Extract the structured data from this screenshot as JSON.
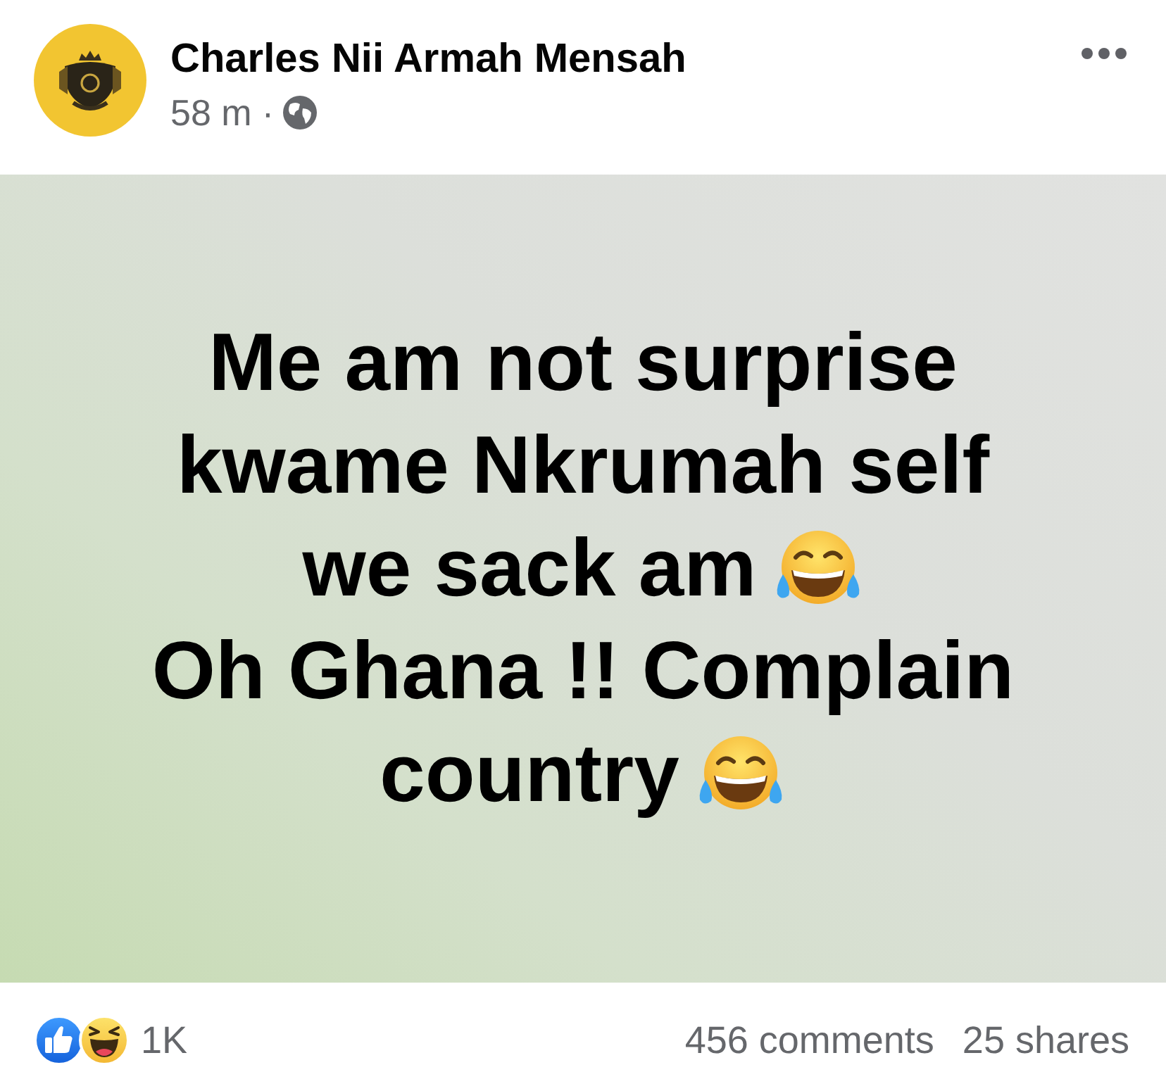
{
  "post": {
    "author": "Charles Nii Armah Mensah",
    "time": "58 m",
    "separator": "·"
  },
  "content": {
    "lines": [
      {
        "text": "Me am not surprise",
        "emoji": false
      },
      {
        "text": "kwame Nkrumah self",
        "emoji": false
      },
      {
        "text": "we sack am",
        "emoji": true
      },
      {
        "text": "Oh Ghana !! Complain",
        "emoji": false
      },
      {
        "text": "country",
        "emoji": true
      }
    ]
  },
  "footer": {
    "reaction_count": "1K",
    "comments": "456 comments",
    "shares": "25 shares"
  }
}
